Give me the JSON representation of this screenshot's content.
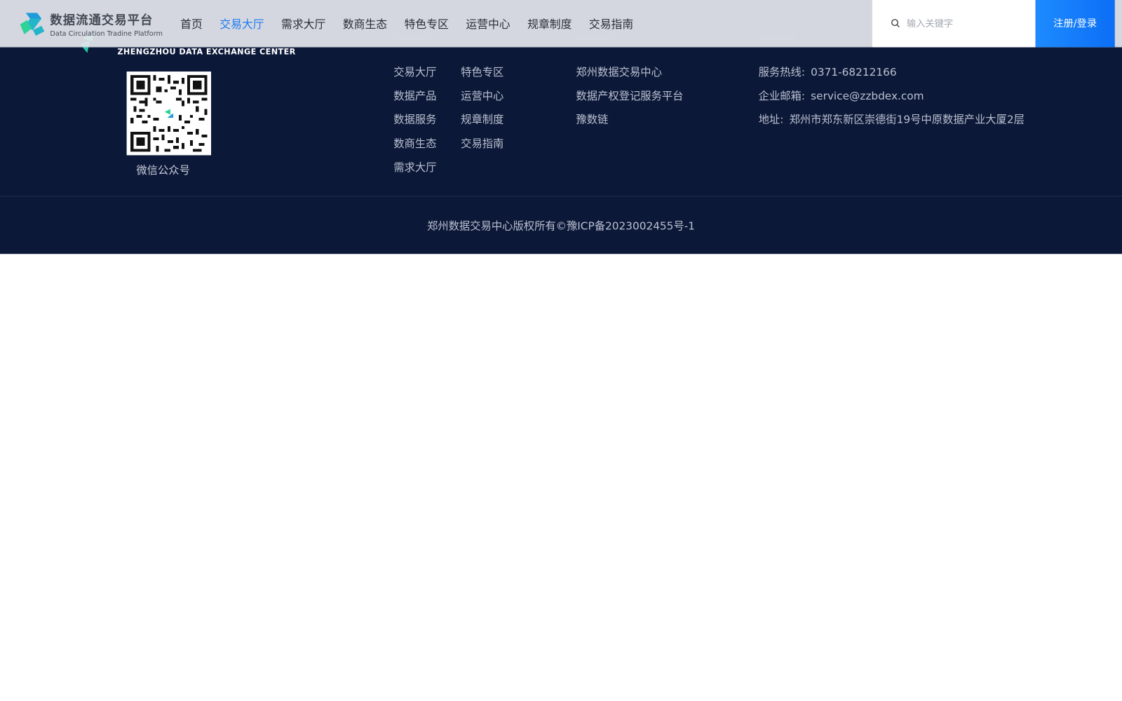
{
  "header": {
    "brand_cn": "数据流通交易平台",
    "brand_en": "Data Circulation Tradine Platform",
    "nav": [
      "首页",
      "交易大厅",
      "需求大厅",
      "数商生态",
      "特色专区",
      "运营中心",
      "规章制度",
      "交易指南"
    ],
    "active_nav": "交易大厅",
    "search_placeholder": "输入关键字",
    "login_label": "注册/登录"
  },
  "footer": {
    "logo_en": "ZHENGZHOU DATA EXCHANGE CENTER",
    "qr_caption": "微信公众号",
    "links_col1": [
      "交易大厅",
      "数据产品",
      "数据服务",
      "数商生态",
      "需求大厅"
    ],
    "links_col2": [
      "特色专区",
      "运营中心",
      "规章制度",
      "交易指南"
    ],
    "links_col3": [
      "郑州数据交易中心",
      "数据产权登记服务平台",
      "豫数链"
    ],
    "contact": {
      "hotline_label": "服务热线:",
      "hotline": "0371-68212166",
      "email_label": "企业邮箱:",
      "email": "service@zzbdex.com",
      "address_label": "地址:",
      "address": "郑州市郑东新区崇德街19号中原数据产业大厦2层"
    },
    "copyright": "郑州数据交易中心版权所有©豫ICP备2023002455号-1"
  },
  "colors": {
    "footer_bg": "#0c1838",
    "accent": "#1f7bf2",
    "login_bg": "#0c6ef5"
  }
}
